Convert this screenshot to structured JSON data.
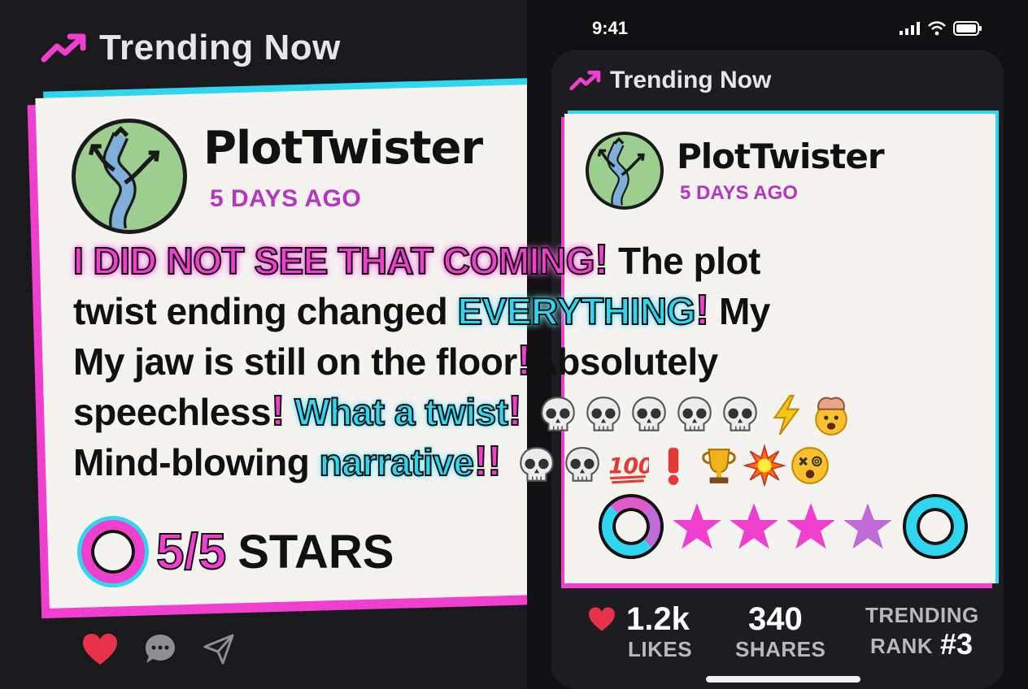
{
  "header": {
    "title": "Trending Now",
    "icon": "trending-arrow-icon",
    "accent": "#f03ecf"
  },
  "status_bar": {
    "time": "9:41",
    "icons": [
      "signal-icon",
      "wifi-icon",
      "battery-icon"
    ]
  },
  "post": {
    "username": "PlotTwister",
    "timestamp": "5 DAYS AGO",
    "avatar": "forking-arrows-avatar",
    "lines": {
      "l1_highlight": "I DID NOT SEE THAT COMING",
      "l1_rest": "The plot",
      "l2_start": "twist ending changed",
      "l2_highlight": "EVERYTHING",
      "l2_end": "My",
      "l3_start": "My jaw is still on the floor",
      "l3_end": "Absolutely",
      "l4_start": "speechless",
      "l4_highlight": "What a twist",
      "l5_start": "Mind-blowing",
      "l5_highlight": "narrative"
    },
    "bang": "!",
    "bang_double": "!!",
    "emojis_line4": [
      "skull-emoji",
      "skull-emoji",
      "skull-emoji",
      "skull-emoji",
      "skull-emoji",
      "lightning-emoji",
      "mind-blown-emoji"
    ],
    "emojis_line5": [
      "skull-emoji",
      "skull-emoji",
      "hundred-emoji",
      "exclamation-emoji",
      "trophy-emoji",
      "explosion-emoji",
      "dizzy-face-emoji"
    ],
    "rating_left": {
      "score": "5/5",
      "label": "STARS"
    },
    "rating_right": {
      "stars_filled": 4,
      "stars_total": 4
    }
  },
  "actions_left": [
    "heart-icon",
    "comment-icon",
    "share-icon"
  ],
  "stats": {
    "likes_value": "1.2k",
    "likes_label": "LIKES",
    "shares_value": "340",
    "shares_label": "SHARES",
    "rank_label_top": "TRENDING",
    "rank_label_bottom": "RANK",
    "rank_value": "#3"
  },
  "colors": {
    "pink": "#f03ecf",
    "cyan": "#2fd6f0",
    "purple_time": "#b834c2",
    "heart_red": "#e8324a"
  }
}
